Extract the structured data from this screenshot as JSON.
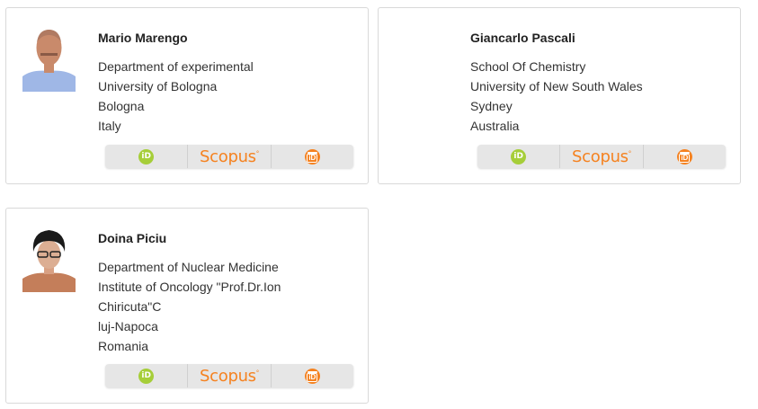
{
  "authors": [
    {
      "name": "Mario Marengo",
      "lines": [
        "Department of experimental",
        "University of Bologna",
        "Bologna",
        "Italy"
      ],
      "has_photo": true
    },
    {
      "name": "Giancarlo Pascali",
      "lines": [
        "School Of Chemistry",
        "University of New South Wales",
        "Sydney",
        "Australia"
      ],
      "has_photo": false
    },
    {
      "name": "Doina Piciu",
      "lines": [
        "Department of Nuclear Medicine",
        "Institute of Oncology \"Prof.Dr.Ion",
        "Chiricuta\"C",
        "luj-Napoca",
        "Romania"
      ],
      "has_photo": true
    }
  ],
  "id_links": {
    "orcid_label": "iD",
    "scopus_label": "Scopus",
    "scopus_mark": "°",
    "publons_label": "iD"
  },
  "colors": {
    "orcid": "#a6ce39",
    "scopus": "#f58220",
    "publons": "#f58220"
  },
  "icons": [
    "orcid-icon",
    "scopus-logo",
    "publons-icon"
  ]
}
